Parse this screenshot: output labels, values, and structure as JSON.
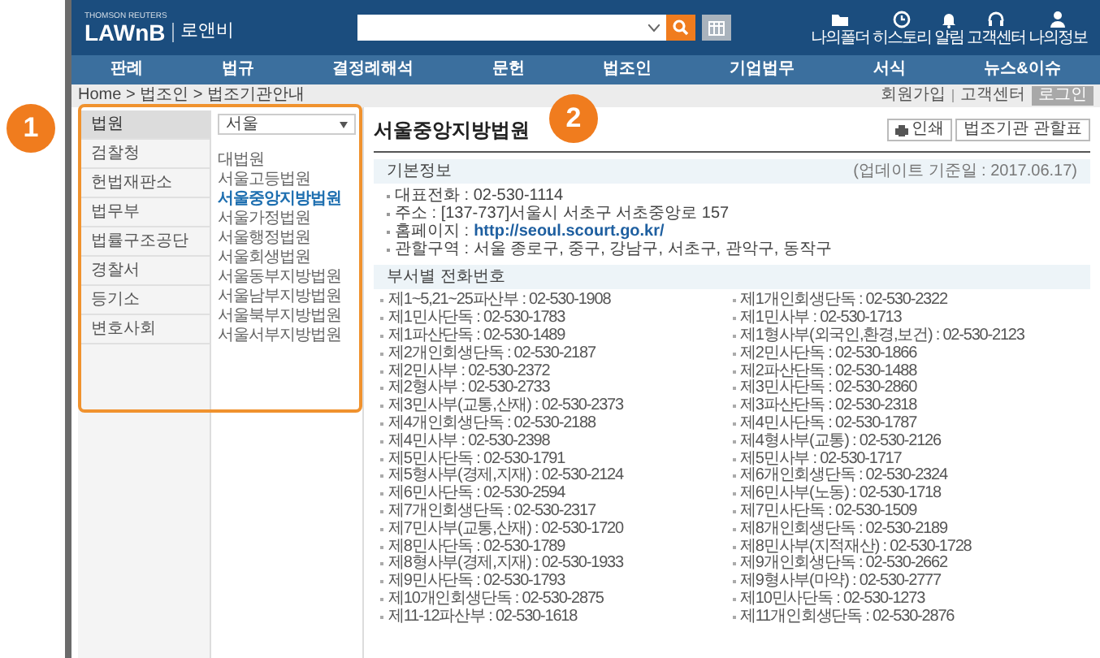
{
  "annotations": [
    {
      "label": "1"
    },
    {
      "label": "2"
    }
  ],
  "header": {
    "tagline": "THOMSON REUTERS",
    "brand": "LAWnB",
    "name": "로앤비",
    "icons": [
      {
        "kind": "folder",
        "label": "나의폴더"
      },
      {
        "kind": "history",
        "label": "히스토리"
      },
      {
        "kind": "bell",
        "label": "알림"
      },
      {
        "kind": "headset",
        "label": "고객센터"
      },
      {
        "kind": "person",
        "label": "나의정보"
      }
    ]
  },
  "nav": [
    "판례",
    "법규",
    "결정례해석",
    "문헌",
    "법조인",
    "기업법무",
    "서식",
    "뉴스&이슈"
  ],
  "breadcrumb": "Home > 법조인 > 법조기관안내",
  "top_links": [
    {
      "label": "회원가입",
      "kind": "link"
    },
    {
      "label": "고객센터",
      "kind": "link"
    },
    {
      "label": "로그인",
      "kind": "button"
    }
  ],
  "categories": [
    {
      "label": "법원",
      "selected": true
    },
    {
      "label": "검찰청",
      "selected": false
    },
    {
      "label": "헌법재판소",
      "selected": false
    },
    {
      "label": "법무부",
      "selected": false
    },
    {
      "label": "법률구조공단",
      "selected": false
    },
    {
      "label": "경찰서",
      "selected": false
    },
    {
      "label": "등기소",
      "selected": false
    },
    {
      "label": "변호사회",
      "selected": false
    }
  ],
  "region_select": {
    "value": "서울"
  },
  "courts": [
    {
      "label": "대법원",
      "selected": false
    },
    {
      "label": "서울고등법원",
      "selected": false
    },
    {
      "label": "서울중앙지방법원",
      "selected": true
    },
    {
      "label": "서울가정법원",
      "selected": false
    },
    {
      "label": "서울행정법원",
      "selected": false
    },
    {
      "label": "서울회생법원",
      "selected": false
    },
    {
      "label": "서울동부지방법원",
      "selected": false
    },
    {
      "label": "서울남부지방법원",
      "selected": false
    },
    {
      "label": "서울북부지방법원",
      "selected": false
    },
    {
      "label": "서울서부지방법원",
      "selected": false
    }
  ],
  "page_title": "서울중앙지방법원",
  "actions": [
    {
      "kind": "print",
      "label": "인쇄"
    },
    {
      "kind": "plain",
      "label": "법조기관 관할표"
    }
  ],
  "basic_info": {
    "title": "기본정보",
    "updated": "(업데이트 기준일 : 2017.06.17)",
    "items": [
      {
        "text": "대표전화 : 02-530-1114"
      },
      {
        "text": "주소 : [137-737]서울시 서초구 서초중앙로 157"
      },
      {
        "text": "홈페이지 :",
        "link": "http://seoul.scourt.go.kr/"
      },
      {
        "text": "관할구역 : 서울 종로구, 중구, 강남구, 서초구, 관악구, 동작구"
      }
    ]
  },
  "phones": {
    "title": "부서별 전화번호",
    "left": [
      "제1~5,21~25파산부 : 02-530-1908",
      "제1민사단독 : 02-530-1783",
      "제1파산단독 : 02-530-1489",
      "제2개인회생단독 : 02-530-2187",
      "제2민사부 : 02-530-2372",
      "제2형사부 : 02-530-2733",
      "제3민사부(교통,산재) : 02-530-2373",
      "제4개인회생단독 : 02-530-2188",
      "제4민사부 : 02-530-2398",
      "제5민사단독 : 02-530-1791",
      "제5형사부(경제,지재) : 02-530-2124",
      "제6민사단독 : 02-530-2594",
      "제7개인회생단독 : 02-530-2317",
      "제7민사부(교통,산재) : 02-530-1720",
      "제8민사단독 : 02-530-1789",
      "제8형사부(경제,지재) : 02-530-1933",
      "제9민사단독 : 02-530-1793",
      "제10개인회생단독 : 02-530-2875",
      "제11-12파산부 : 02-530-1618"
    ],
    "right": [
      "제1개인회생단독 : 02-530-2322",
      "제1민사부 : 02-530-1713",
      "제1형사부(외국인,환경,보건) : 02-530-2123",
      "제2민사단독 : 02-530-1866",
      "제2파산단독 : 02-530-1488",
      "제3민사단독 : 02-530-2860",
      "제3파산단독 : 02-530-2318",
      "제4민사단독 : 02-530-1787",
      "제4형사부(교통) : 02-530-2126",
      "제5민사부 : 02-530-1717",
      "제6개인회생단독 : 02-530-2324",
      "제6민사부(노동) : 02-530-1718",
      "제7민사단독 : 02-530-1509",
      "제8개인회생단독 : 02-530-2189",
      "제8민사부(지적재산) : 02-530-1728",
      "제9개인회생단독 : 02-530-2662",
      "제9형사부(마약) : 02-530-2777",
      "제10민사단독 : 02-530-1273",
      "제11개인회생단독 : 02-530-2876"
    ]
  }
}
